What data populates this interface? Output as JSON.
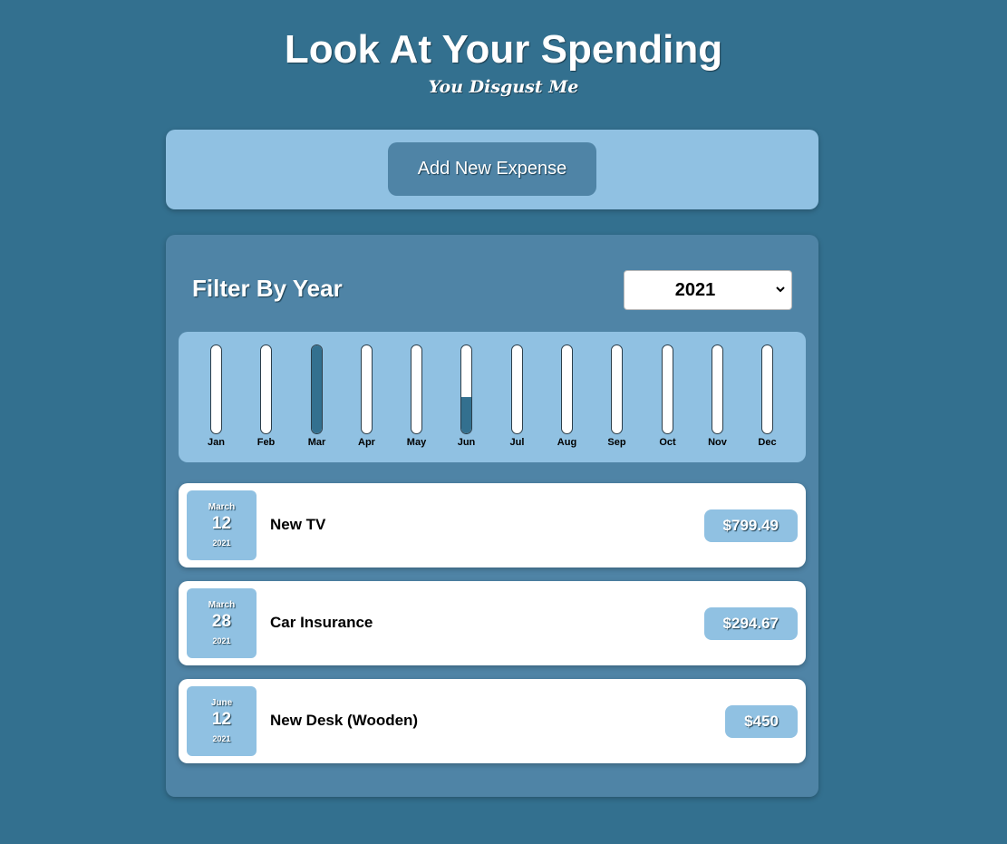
{
  "header": {
    "title": "Look At Your Spending",
    "subtitle": "You Disgust Me"
  },
  "new_expense": {
    "button_label": "Add New Expense"
  },
  "filter": {
    "label": "Filter By Year",
    "selected_year": "2021"
  },
  "chart": {
    "months": [
      {
        "label": "Jan",
        "fill": 0
      },
      {
        "label": "Feb",
        "fill": 0
      },
      {
        "label": "Mar",
        "fill": 1.0
      },
      {
        "label": "Apr",
        "fill": 0
      },
      {
        "label": "May",
        "fill": 0
      },
      {
        "label": "Jun",
        "fill": 0.41
      },
      {
        "label": "Jul",
        "fill": 0
      },
      {
        "label": "Aug",
        "fill": 0
      },
      {
        "label": "Sep",
        "fill": 0
      },
      {
        "label": "Oct",
        "fill": 0
      },
      {
        "label": "Nov",
        "fill": 0
      },
      {
        "label": "Dec",
        "fill": 0
      }
    ]
  },
  "expenses": [
    {
      "month": "March",
      "day": "12",
      "year": "2021",
      "title": "New TV",
      "amount": "$799.49"
    },
    {
      "month": "March",
      "day": "28",
      "year": "2021",
      "title": "Car Insurance",
      "amount": "$294.67"
    },
    {
      "month": "June",
      "day": "12",
      "year": "2021",
      "title": "New Desk (Wooden)",
      "amount": "$450"
    }
  ],
  "colors": {
    "background": "#33708f",
    "panel": "#4f84a6",
    "light_panel": "#90c1e2",
    "bar_fill": "#33708f"
  }
}
